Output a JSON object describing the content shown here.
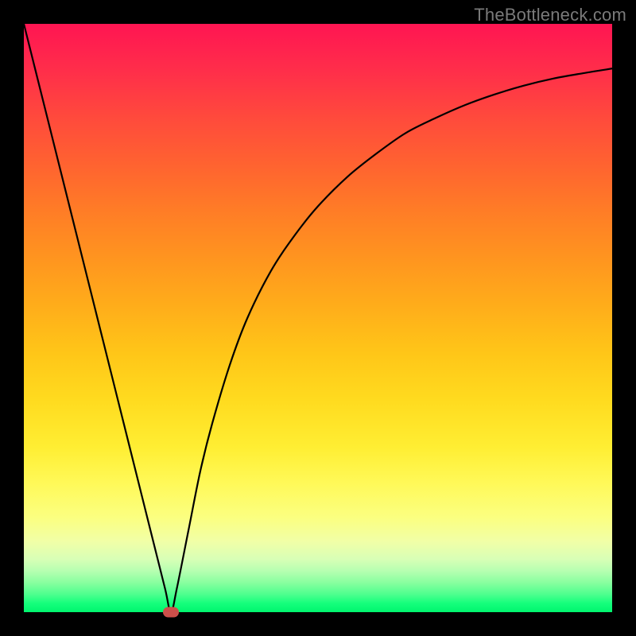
{
  "watermark": "TheBottleneck.com",
  "chart_data": {
    "type": "line",
    "title": "",
    "xlabel": "",
    "ylabel": "",
    "xlim": [
      0,
      100
    ],
    "ylim": [
      0,
      100
    ],
    "grid": false,
    "legend": false,
    "series": [
      {
        "name": "bottleneck-curve",
        "x": [
          0,
          2,
          4,
          6,
          8,
          10,
          12,
          14,
          16,
          18,
          20,
          22,
          24,
          25,
          26,
          28,
          30,
          32,
          35,
          38,
          42,
          46,
          50,
          55,
          60,
          65,
          70,
          75,
          80,
          85,
          90,
          95,
          100
        ],
        "values": [
          100,
          92,
          84,
          76,
          68,
          60,
          52,
          44,
          36,
          28,
          20,
          12,
          4,
          0,
          4,
          14,
          24,
          32,
          42,
          50,
          58,
          64,
          69,
          74,
          78,
          81.5,
          84,
          86.2,
          88,
          89.5,
          90.7,
          91.6,
          92.4
        ]
      }
    ],
    "marker": {
      "x": 25,
      "y": 0,
      "color": "#cc4f4a"
    },
    "gradient_stops": [
      {
        "pos": 0,
        "color": "#ff1552"
      },
      {
        "pos": 16,
        "color": "#ff4a3c"
      },
      {
        "pos": 40,
        "color": "#ff951f"
      },
      {
        "pos": 64,
        "color": "#ffdb1f"
      },
      {
        "pos": 84,
        "color": "#f1ffa7"
      },
      {
        "pos": 95,
        "color": "#88ff9f"
      },
      {
        "pos": 100,
        "color": "#00f56e"
      }
    ]
  }
}
